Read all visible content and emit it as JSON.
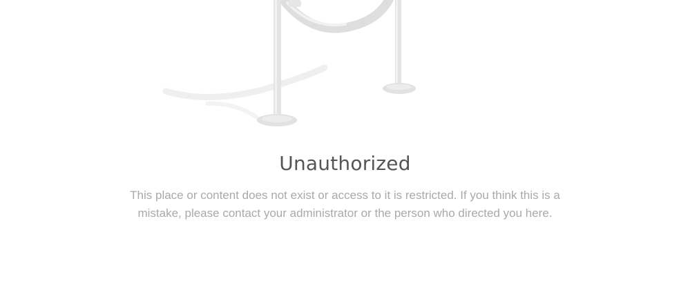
{
  "illustration": {
    "icon": "velvet-rope-stanchion-icon",
    "color": "#e3e3e3"
  },
  "error": {
    "title": "Unauthorized",
    "message": "This place or content does not exist or access to it is restricted. If you think this is a mistake, please contact your administrator or the person who directed you here."
  }
}
